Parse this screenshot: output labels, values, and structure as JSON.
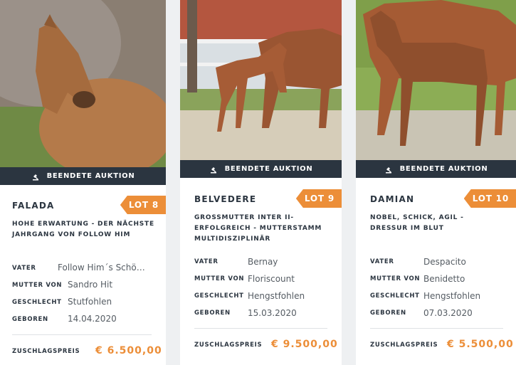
{
  "cards": [
    {
      "status": "BEENDETE AUKTION",
      "lot": "LOT 8",
      "name": "FALADA",
      "tagline": "HOHE ERWARTUNG - DER NÄCHSTE JAHRGANG VON FOLLOW HIM",
      "props": [
        {
          "label": "VATER",
          "value": "Follow Him´s Schö…"
        },
        {
          "label": "MUTTER VON",
          "value": "Sandro Hit"
        },
        {
          "label": "GESCHLECHT",
          "value": "Stutfohlen"
        },
        {
          "label": "GEBOREN",
          "value": "14.04.2020"
        }
      ],
      "price_label": "ZUSCHLAGSPREIS",
      "price": "€ 6.500,00"
    },
    {
      "status": "BEENDETE AUKTION",
      "lot": "LOT 9",
      "name": "BELVEDERE",
      "tagline": "GROSSMUTTER INTER II-ERFOLGREICH - MUTTERSTAMM MULTIDISZIPLINÄR",
      "props": [
        {
          "label": "VATER",
          "value": "Bernay"
        },
        {
          "label": "MUTTER VON",
          "value": "Floriscount"
        },
        {
          "label": "GESCHLECHT",
          "value": "Hengstfohlen"
        },
        {
          "label": "GEBOREN",
          "value": "15.03.2020"
        }
      ],
      "price_label": "ZUSCHLAGSPREIS",
      "price": "€ 9.500,00"
    },
    {
      "status": "BEENDETE AUKTION",
      "lot": "LOT 10",
      "name": "DAMIAN",
      "tagline": "NOBEL, SCHICK, AGIL - DRESSUR IM BLUT",
      "props": [
        {
          "label": "VATER",
          "value": "Despacito"
        },
        {
          "label": "MUTTER VON",
          "value": "Benidetto"
        },
        {
          "label": "GESCHLECHT",
          "value": "Hengstfohlen"
        },
        {
          "label": "GEBOREN",
          "value": "07.03.2020"
        }
      ],
      "price_label": "ZUSCHLAGSPREIS",
      "price": "€ 5.500,00"
    }
  ],
  "colors": {
    "accent": "#ec8e38",
    "dark": "#2b3540"
  },
  "icons": {
    "status": "gavel-icon"
  }
}
